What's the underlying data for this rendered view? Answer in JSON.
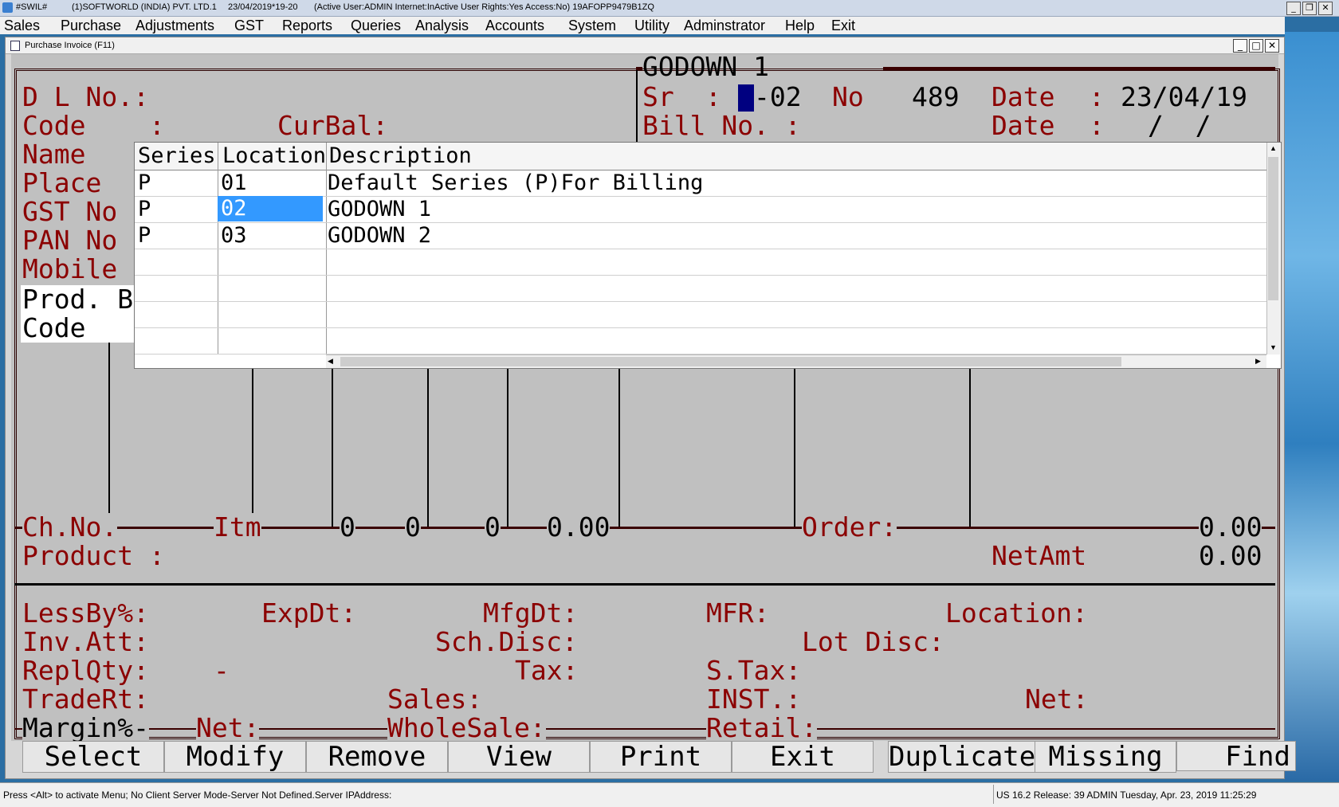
{
  "titlebar": {
    "app": "#SWIL#",
    "company": "(1)SOFTWORLD (INDIA) PVT. LTD.1",
    "datetime": "23/04/2019*19-20",
    "info": "(Active User:ADMIN Internet:InActive User Rights:Yes Access:No) 19AFOPP9479B1ZQ"
  },
  "menu": [
    "Sales",
    "Purchase",
    "Adjustments",
    "GST",
    "Reports",
    "Queries",
    "Analysis",
    "Accounts",
    "System",
    "Utility",
    "Adminstrator",
    "Help",
    "Exit"
  ],
  "window": {
    "title": "Purchase Invoice   (F11)"
  },
  "header": {
    "godown": "GODOWN 1",
    "sr_label": "Sr",
    "sr_colon": ":",
    "sr_value": "-02",
    "no_label": "No",
    "no_value": "489",
    "date_label": "Date",
    "date_colon": ":",
    "date_value": "23/04/19",
    "bill_label": "Bill No. :",
    "date2_label": "Date",
    "date2_colon": ":",
    "date2_value": "/  /"
  },
  "left_labels": {
    "dl": "D L No.:",
    "code": "Code    :",
    "curbal": "CurBal:",
    "name": "Name",
    "place": "Place",
    "gst": "GST No",
    "pan": "PAN No",
    "mobile": "Mobile",
    "prod_b": "Prod. B",
    "code2": "Code"
  },
  "dropdown": {
    "headers": [
      "Series",
      "Location",
      "Description"
    ],
    "rows": [
      {
        "series": "P",
        "location": "01",
        "description": "Default Series (P)For Billing"
      },
      {
        "series": "P",
        "location": "02",
        "description": "GODOWN 1"
      },
      {
        "series": "P",
        "location": "03",
        "description": "GODOWN 2"
      }
    ],
    "selected_row": 1
  },
  "grid_footer": {
    "chno": "Ch.No.",
    "itm": "Itm",
    "v1": "0",
    "v2": "0",
    "v3": "0",
    "v4": "0.00",
    "order": "Order:",
    "order_val": "0.00",
    "product": "Product :",
    "netamt": "NetAmt",
    "netamt_val": "0.00"
  },
  "bottom": {
    "lessby": "LessBy%:",
    "expdt": "ExpDt:",
    "mfgdt": "MfgDt:",
    "mfr": "MFR:",
    "location": "Location:",
    "invatt": "Inv.Att:",
    "schdisc": "Sch.Disc:",
    "lotdisc": "Lot Disc:",
    "replqty": "ReplQty:",
    "dash": "-",
    "tax": "Tax:",
    "stax": "S.Tax:",
    "tradert": "TradeRt:",
    "sales": "Sales:",
    "inst": "INST.:",
    "net": "Net:",
    "margin": "Margin%-",
    "net2": "Net:",
    "wholesale": "WholeSale:",
    "retail": "Retail:"
  },
  "buttons": [
    "Select",
    "Modify",
    "Remove",
    "View",
    "Print",
    "Exit",
    "Duplicate",
    "Missing",
    "Find"
  ],
  "status": {
    "left": "Press <Alt> to activate Menu; No Client Server Mode-Server Not Defined.Server IPAddress:",
    "right": "US 16.2 Release: 39  ADMIN  Tuesday, Apr. 23, 2019  11:25:29"
  },
  "colors": {
    "label_red": "#8b0000",
    "selection": "#3399ff",
    "cursor": "#000080"
  }
}
